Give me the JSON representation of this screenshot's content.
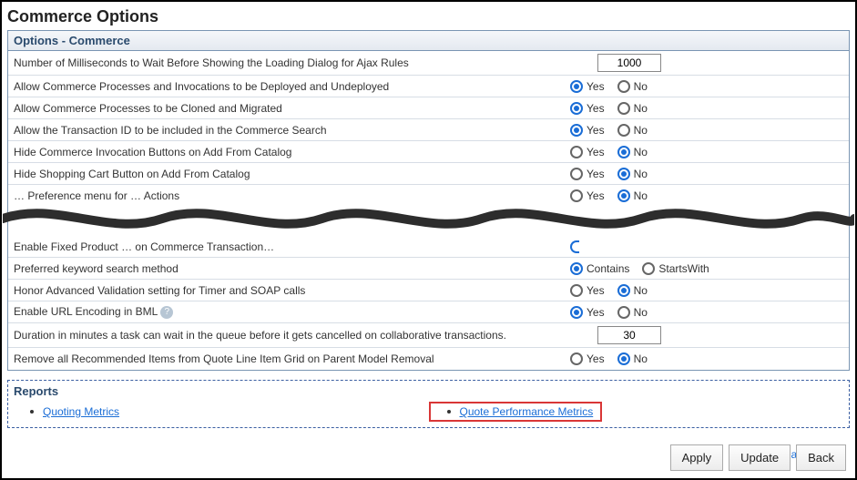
{
  "page_title": "Commerce Options",
  "options_panel": {
    "header": "Options - Commerce",
    "rows_top": [
      {
        "label": "Number of Milliseconds to Wait Before Showing the Loading Dialog for Ajax Rules",
        "type": "number",
        "value": "1000"
      },
      {
        "label": "Allow Commerce Processes and Invocations to be Deployed and Undeployed",
        "type": "yesno",
        "yes": true
      },
      {
        "label": "Allow Commerce Processes to be Cloned and Migrated",
        "type": "yesno",
        "yes": true
      },
      {
        "label": "Allow the Transaction ID to be included in the Commerce Search",
        "type": "yesno",
        "yes": true
      },
      {
        "label": "Hide Commerce Invocation Buttons on Add From Catalog",
        "type": "yesno",
        "yes": false
      },
      {
        "label": "Hide Shopping Cart Button on Add From Catalog",
        "type": "yesno",
        "yes": false
      },
      {
        "label": "… Preference menu for … Actions",
        "type": "yesno",
        "yes": false
      }
    ],
    "rows_bottom": [
      {
        "label": "Enable Fixed Product … on Commerce Transaction…",
        "type": "partial"
      },
      {
        "label": "Preferred keyword search method",
        "type": "radio2",
        "opt1": "Contains",
        "opt2": "StartsWith",
        "sel1": true
      },
      {
        "label": "Honor Advanced Validation setting for Timer and SOAP calls",
        "type": "yesno",
        "yes": false
      },
      {
        "label": "Enable URL Encoding in BML",
        "type": "yesno",
        "yes": true,
        "help": true
      },
      {
        "label": "Duration in minutes a task can wait in the queue before it gets cancelled on collaborative transactions.",
        "type": "number",
        "value": "30"
      },
      {
        "label": "Remove all Recommended Items from Quote Line Item Grid on Parent Model Removal",
        "type": "yesno",
        "yes": false
      }
    ]
  },
  "yes_label": "Yes",
  "no_label": "No",
  "reports": {
    "header": "Reports",
    "links": {
      "quoting": "Quoting Metrics",
      "quote_perf": "Quote Performance Metrics"
    }
  },
  "back_to_top": "Back to Top",
  "buttons": {
    "apply": "Apply",
    "update": "Update",
    "back": "Back"
  }
}
